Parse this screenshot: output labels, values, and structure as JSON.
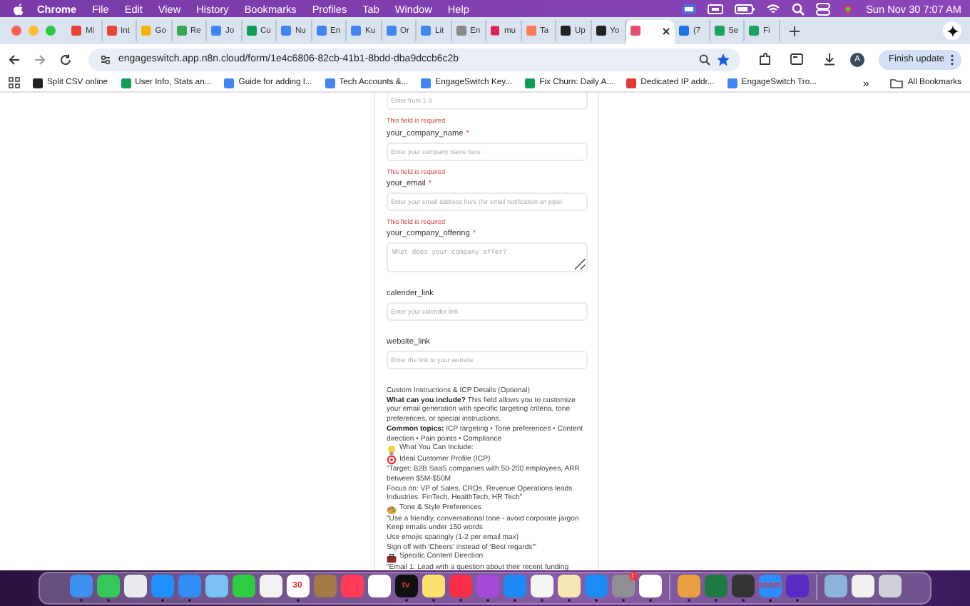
{
  "menu_bar": {
    "app": "Chrome",
    "items": [
      "File",
      "Edit",
      "View",
      "History",
      "Bookmarks",
      "Profiles",
      "Tab",
      "Window",
      "Help"
    ],
    "clock": "Sun Nov 30  7:07 AM"
  },
  "tabs": [
    {
      "title": "Mi",
      "color": "#ea4335",
      "selected": false
    },
    {
      "title": "Int",
      "color": "#ea4335",
      "selected": false
    },
    {
      "title": "Go",
      "color": "#f4b400",
      "selected": false
    },
    {
      "title": "Re",
      "color": "#34a853",
      "selected": false
    },
    {
      "title": "Jo",
      "color": "#4285f4",
      "selected": false
    },
    {
      "title": "Cu",
      "color": "#0f9d58",
      "selected": false
    },
    {
      "title": "Nu",
      "color": "#4285f4",
      "selected": false
    },
    {
      "title": "En",
      "color": "#4285f4",
      "selected": false
    },
    {
      "title": "Ku",
      "color": "#4285f4",
      "selected": false
    },
    {
      "title": "Or",
      "color": "#4285f4",
      "selected": false
    },
    {
      "title": "Lit",
      "color": "#4285f4",
      "selected": false
    },
    {
      "title": "En",
      "color": "#8a8a8a",
      "selected": false
    },
    {
      "title": "mu",
      "color": "#e01e5a",
      "selected": false
    },
    {
      "title": "Ta",
      "color": "#ff7a59",
      "selected": false
    },
    {
      "title": "Up",
      "color": "#222222",
      "selected": false
    },
    {
      "title": "Yo",
      "color": "#222222",
      "selected": false
    },
    {
      "color": "#ea4b71",
      "selected": true
    },
    {
      "title": "(7",
      "color": "#1a73e8",
      "selected": false
    },
    {
      "title": "Se",
      "color": "#1aa260",
      "selected": false
    },
    {
      "title": "Fi",
      "color": "#1aa260",
      "selected": false
    }
  ],
  "address_bar": {
    "url": "engageswitch.app.n8n.cloud/form/1e4c6806-82cb-41b1-8bdd-dba9dccb6c2b",
    "bookmarked": true
  },
  "profile": {
    "initial": "A"
  },
  "update_button": "Finish update",
  "bookmarks": [
    {
      "title": "Split CSV online",
      "color": "#222222"
    },
    {
      "title": "User Info, Stats an...",
      "color": "#0f9d58"
    },
    {
      "title": "Guide for adding l...",
      "color": "#4285f4"
    },
    {
      "title": "Tech Accounts &...",
      "color": "#4285f4"
    },
    {
      "title": "EngageSwitch Key...",
      "color": "#4285f4"
    },
    {
      "title": "Fix Churn: Daily A...",
      "color": "#0f9d58"
    },
    {
      "title": "Dedicated IP addr...",
      "color": "#e53935"
    },
    {
      "title": "EngageSwitch Tro...",
      "color": "#4285f4"
    }
  ],
  "bookmarks_more": "»",
  "all_bookmarks": "All Bookmarks",
  "form": {
    "fields": [
      {
        "kind": "input",
        "placeholder": "Enter from 1-3",
        "error": "This field is required"
      },
      {
        "label": "your_company_name",
        "required_mark": "*",
        "kind": "input",
        "placeholder": "Enter your company name here",
        "error": "This field is required"
      },
      {
        "label": "your_email",
        "required_mark": "*",
        "kind": "input",
        "placeholder": "Enter your email address here (for email notification on pipel",
        "error": "This field is required"
      },
      {
        "label": "your_company_offering",
        "required_mark": "*",
        "kind": "textarea",
        "placeholder": "What does your company offer?"
      },
      {
        "label": "calender_link",
        "kind": "input",
        "placeholder": "Enter your calender link"
      },
      {
        "label": "website_link",
        "kind": "input",
        "placeholder": "Enter the link to your website"
      }
    ],
    "description": [
      {
        "text": "Custom Instructions & ICP Details (Optional)",
        "kind": "plain"
      },
      {
        "text": "**What can you include?** This field allows you to customize your email generation with specific targeting criteria, tone preferences, or special instructions.",
        "kind": "plain"
      },
      {
        "text": "**Common topics:** ICP targeting • Tone preferences • Content direction • Pain points • Compliance",
        "kind": "plain"
      },
      {
        "text": "What You Can Include:",
        "kind": "bulb"
      },
      {
        "text": "Ideal Customer Profile (ICP)",
        "kind": "target"
      },
      {
        "text": "\"Target: B2B SaaS companies with 50-200 employees, ARR between $5M-$50M",
        "kind": "plain"
      },
      {
        "text": "Focus on: VP of Sales, CROs, Revenue Operations leads",
        "kind": "plain"
      },
      {
        "text": "Industries: FinTech, HealthTech, HR Tech\"",
        "kind": "plain"
      },
      {
        "text": "Tone & Style Preferences",
        "kind": "palette"
      },
      {
        "text": "\"Use a friendly, conversational tone - avoid corporate jargon",
        "kind": "plain"
      },
      {
        "text": "Keep emails under 150 words",
        "kind": "plain"
      },
      {
        "text": "Use emojis sparingly (1-2 per email max)",
        "kind": "plain"
      },
      {
        "text": "Sign off with 'Cheers' instead of 'Best regards'\"",
        "kind": "plain"
      },
      {
        "text": "Specific Content Direction",
        "kind": "briefcase"
      },
      {
        "text": "\"Email 1: Lead with a question about their recent funding",
        "kind": "plain"
      }
    ]
  },
  "dock": [
    {
      "color": "#3d8ff0",
      "running": true
    },
    {
      "color": "#34c759",
      "running": true
    },
    {
      "color": "#e9e9ef",
      "running": false
    },
    {
      "color": "#1e90ff",
      "running": true
    },
    {
      "color": "#2f8df5",
      "running": true
    },
    {
      "color": "#7ac0f5",
      "running": false
    },
    {
      "color": "#2ecc40",
      "running": false
    },
    {
      "color": "#f2f2f2",
      "running": false
    },
    {
      "color": "#ffffff",
      "running": true,
      "label": "30"
    },
    {
      "color": "#a57945",
      "running": false
    },
    {
      "color": "#ff3b55",
      "running": false
    },
    {
      "color": "#ffffff",
      "running": false
    },
    {
      "color": "#111111",
      "running": true,
      "label": "tv"
    },
    {
      "color": "#fbe36e",
      "running": true
    },
    {
      "color": "#fa2d48",
      "running": true
    },
    {
      "color": "#a24bd8",
      "running": true
    },
    {
      "color": "#1b8af5",
      "running": true
    },
    {
      "color": "#f5f5f5",
      "running": true
    },
    {
      "color": "#f7e6b4",
      "running": true
    },
    {
      "color": "#1c8cf5",
      "running": true
    },
    {
      "color": "#8e8e93",
      "running": true,
      "badge": "1"
    },
    {
      "color": "#ffffff",
      "running": true
    },
    {
      "color": "#e9a040",
      "running": true
    },
    {
      "color": "#1d7a43",
      "running": true
    },
    {
      "color": "#333333",
      "running": true
    },
    {
      "color": "#2d8cff",
      "running": true,
      "label": "zoom"
    },
    {
      "color": "#5b2ac2",
      "running": true
    },
    {
      "color": "#8ab4d8",
      "running": false
    },
    {
      "color": "#f0f0f0",
      "running": false
    },
    {
      "color": "#d0d0d8",
      "running": false
    }
  ]
}
